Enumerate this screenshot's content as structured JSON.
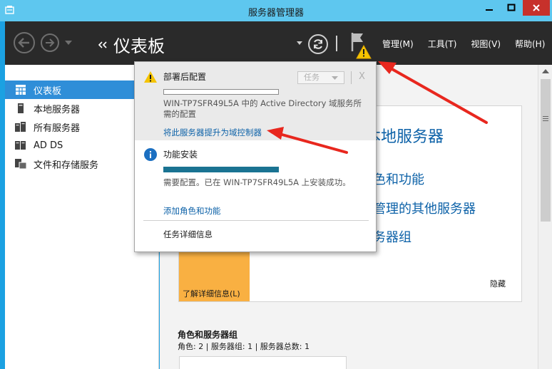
{
  "window": {
    "title": "服务器管理器"
  },
  "header": {
    "page_title": "仪表板",
    "menu": [
      "管理(M)",
      "工具(T)",
      "视图(V)",
      "帮助(H)"
    ]
  },
  "sidebar": {
    "items": [
      {
        "label": "仪表板",
        "icon": "dashboard-icon",
        "active": true
      },
      {
        "label": "本地服务器",
        "icon": "server-icon",
        "active": false
      },
      {
        "label": "所有服务器",
        "icon": "servers-icon",
        "active": false
      },
      {
        "label": "AD DS",
        "icon": "ad-ds-icon",
        "active": false
      },
      {
        "label": "文件和存储服务",
        "icon": "file-storage-icon",
        "active": false
      }
    ]
  },
  "notifications": {
    "post_deploy": {
      "title": "部署后配置",
      "task_dropdown": "任务",
      "close": "X",
      "message": "WIN-TP7SFR49L5A 中的 Active Directory 域服务所需的配置",
      "link": "将此服务器提升为域控制器"
    },
    "feature_install": {
      "title": "功能安装",
      "message": "需要配置。已在 WIN-TP7SFR49L5A 上安装成功。",
      "progress_percent": 100,
      "link": "添加角色和功能"
    },
    "task_details": "任务详细信息"
  },
  "main": {
    "configure_title": "本地服务器",
    "quick_links": [
      "色和功能",
      "管理的其他服务器",
      "务器组"
    ],
    "learn_more": "了解详细信息(L)",
    "hide": "隐藏",
    "roles_heading": "角色和服务器组",
    "roles_summary": "角色: 2 | 服务器组: 1 | 服务器总数: 1"
  },
  "colors": {
    "titlebar": "#5ec7ef",
    "header": "#2a2a2a",
    "active_item": "#2f8ed8",
    "link": "#0d62a8",
    "close_button": "#c7312b",
    "annotation_arrow": "#e8271e",
    "warning": "#f5c400"
  }
}
